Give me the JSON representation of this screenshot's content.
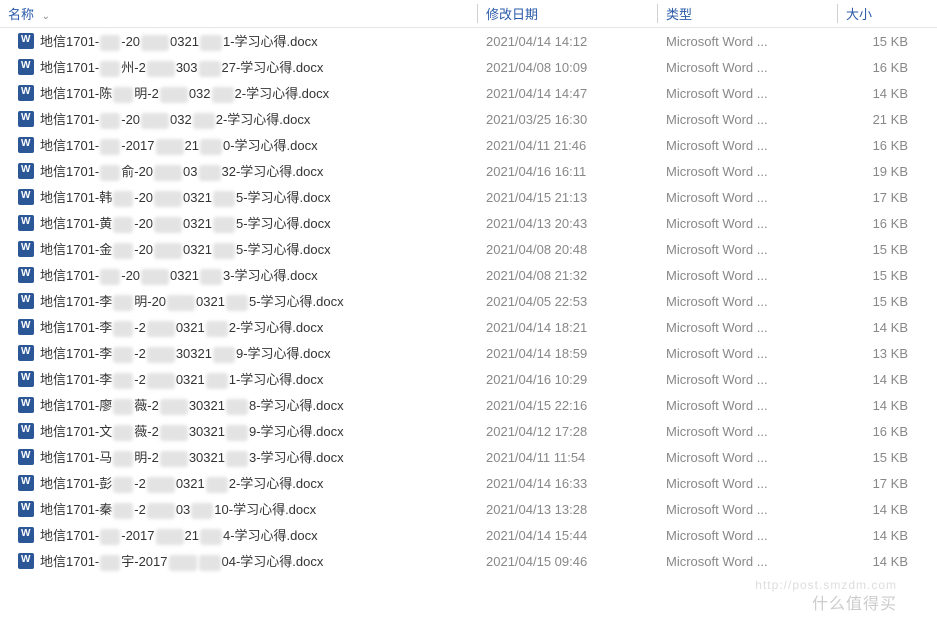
{
  "columns": {
    "name": "名称",
    "date": "修改日期",
    "type": "类型",
    "size": "大小"
  },
  "file_type": "Microsoft Word ...",
  "files": [
    {
      "p1": "地信1701-",
      "p2": "-20",
      "p3": "0321",
      "p4": "1-学习心得.docx",
      "date": "2021/04/14 14:12",
      "size": "15 KB"
    },
    {
      "p1": "地信1701-",
      "p2": "州-2",
      "p3": "303",
      "p4": "27-学习心得.docx",
      "date": "2021/04/08 10:09",
      "size": "16 KB"
    },
    {
      "p1": "地信1701-陈",
      "p2": "明-2",
      "p3": "032",
      "p4": "2-学习心得.docx",
      "date": "2021/04/14 14:47",
      "size": "14 KB"
    },
    {
      "p1": "地信1701-",
      "p2": "-20",
      "p3": "032",
      "p4": "2-学习心得.docx",
      "date": "2021/03/25 16:30",
      "size": "21 KB"
    },
    {
      "p1": "地信1701-",
      "p2": "-2017",
      "p3": "21",
      "p4": "0-学习心得.docx",
      "date": "2021/04/11 21:46",
      "size": "16 KB"
    },
    {
      "p1": "地信1701-",
      "p2": "俞-20",
      "p3": "03",
      "p4": "32-学习心得.docx",
      "date": "2021/04/16 16:11",
      "size": "19 KB"
    },
    {
      "p1": "地信1701-韩",
      "p2": "-20",
      "p3": "0321",
      "p4": "5-学习心得.docx",
      "date": "2021/04/15 21:13",
      "size": "17 KB"
    },
    {
      "p1": "地信1701-黄",
      "p2": "-20",
      "p3": "0321",
      "p4": "5-学习心得.docx",
      "date": "2021/04/13 20:43",
      "size": "16 KB"
    },
    {
      "p1": "地信1701-金",
      "p2": "-20",
      "p3": "0321",
      "p4": "5-学习心得.docx",
      "date": "2021/04/08 20:48",
      "size": "15 KB"
    },
    {
      "p1": "地信1701-",
      "p2": "-20",
      "p3": "0321",
      "p4": "3-学习心得.docx",
      "date": "2021/04/08 21:32",
      "size": "15 KB"
    },
    {
      "p1": "地信1701-李",
      "p2": "明-20",
      "p3": "0321",
      "p4": "5-学习心得.docx",
      "date": "2021/04/05 22:53",
      "size": "15 KB"
    },
    {
      "p1": "地信1701-李",
      "p2": "-2",
      "p3": "0321",
      "p4": "2-学习心得.docx",
      "date": "2021/04/14 18:21",
      "size": "14 KB"
    },
    {
      "p1": "地信1701-李",
      "p2": "-2",
      "p3": "30321",
      "p4": "9-学习心得.docx",
      "date": "2021/04/14 18:59",
      "size": "13 KB"
    },
    {
      "p1": "地信1701-李",
      "p2": "-2",
      "p3": "0321",
      "p4": "1-学习心得.docx",
      "date": "2021/04/16 10:29",
      "size": "14 KB"
    },
    {
      "p1": "地信1701-廖",
      "p2": "薇-2",
      "p3": "30321",
      "p4": "8-学习心得.docx",
      "date": "2021/04/15 22:16",
      "size": "14 KB"
    },
    {
      "p1": "地信1701-文",
      "p2": "薇-2",
      "p3": "30321",
      "p4": "9-学习心得.docx",
      "date": "2021/04/12 17:28",
      "size": "16 KB"
    },
    {
      "p1": "地信1701-马",
      "p2": "明-2",
      "p3": "30321",
      "p4": "3-学习心得.docx",
      "date": "2021/04/11 11:54",
      "size": "15 KB"
    },
    {
      "p1": "地信1701-彭",
      "p2": "-2",
      "p3": "0321",
      "p4": "2-学习心得.docx",
      "date": "2021/04/14 16:33",
      "size": "17 KB"
    },
    {
      "p1": "地信1701-秦",
      "p2": "-2",
      "p3": "03",
      "p4": "10-学习心得.docx",
      "date": "2021/04/13 13:28",
      "size": "14 KB"
    },
    {
      "p1": "地信1701-",
      "p2": "-2017",
      "p3": "21",
      "p4": "4-学习心得.docx",
      "date": "2021/04/14 15:44",
      "size": "14 KB"
    },
    {
      "p1": "地信1701-",
      "p2": "宇-2017",
      "p3": "",
      "p4": "04-学习心得.docx",
      "date": "2021/04/15 09:46",
      "size": "14 KB"
    }
  ],
  "watermark": "什么值得买",
  "watermark2": "http://post.smzdm.com"
}
